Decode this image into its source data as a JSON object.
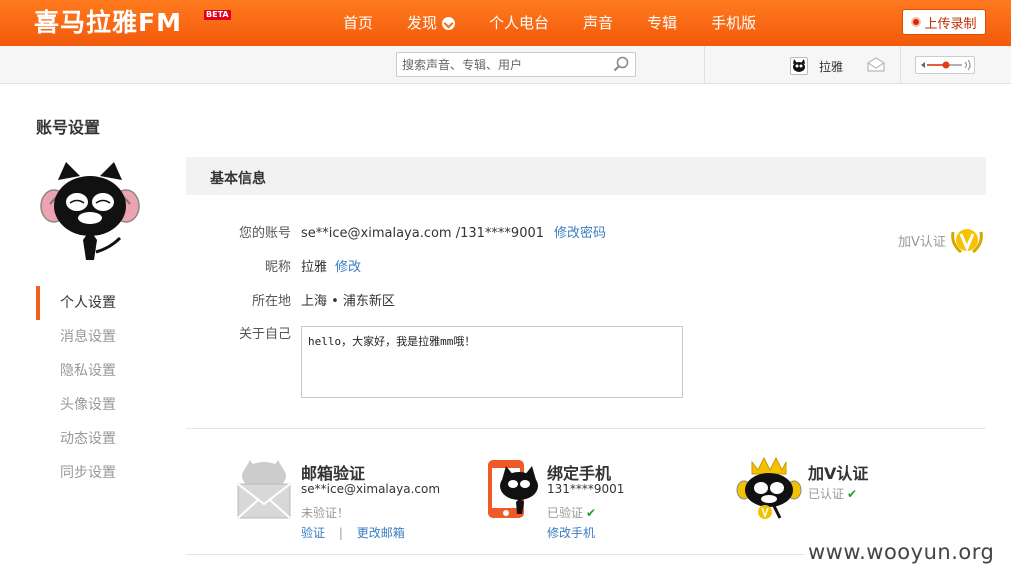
{
  "app": {
    "logo_text": "喜马拉雅FM",
    "beta_badge": "BETA",
    "brand_color": "#f46c16"
  },
  "nav": {
    "items": [
      {
        "label": "首页"
      },
      {
        "label": "发现",
        "has_dropdown": true
      },
      {
        "label": "个人电台"
      },
      {
        "label": "声音"
      },
      {
        "label": "专辑"
      },
      {
        "label": "手机版"
      }
    ],
    "upload_label": "上传录制"
  },
  "search": {
    "placeholder": "搜索声音、专辑、用户",
    "icon": "search-icon"
  },
  "user_bar": {
    "username": "拉雅",
    "mail_icon": "mail-icon",
    "volume_icon": "volume-slider"
  },
  "sidebar": {
    "title": "账号设置",
    "items": [
      {
        "label": "个人设置",
        "active": true
      },
      {
        "label": "消息设置"
      },
      {
        "label": "隐私设置"
      },
      {
        "label": "头像设置"
      },
      {
        "label": "动态设置"
      },
      {
        "label": "同步设置"
      }
    ]
  },
  "basic_info": {
    "heading": "基本信息",
    "account_label": "您的账号",
    "account_value": "se**ice@ximalaya.com /131****9001",
    "change_password": "修改密码",
    "nickname_label": "昵称",
    "nickname_value": "拉雅",
    "nickname_edit": "修改",
    "location_label": "所在地",
    "location_value": "上海 • 浦东新区",
    "about_label": "关于自己",
    "about_value": "hello，大家好，我是拉雅mm哦！",
    "v_badge_label": "加V认证"
  },
  "cards": {
    "email": {
      "title": "邮箱验证",
      "address": "se**ice@ximalaya.com",
      "status": "未验证！",
      "verify": "验证",
      "sep": "|",
      "change": "更改邮箱"
    },
    "phone": {
      "title": "绑定手机",
      "number": "131****9001",
      "status": "已验证",
      "change": "修改手机"
    },
    "vcert": {
      "title": "加V认证",
      "status": "已认证"
    }
  },
  "watermark": "www.wooyun.org"
}
